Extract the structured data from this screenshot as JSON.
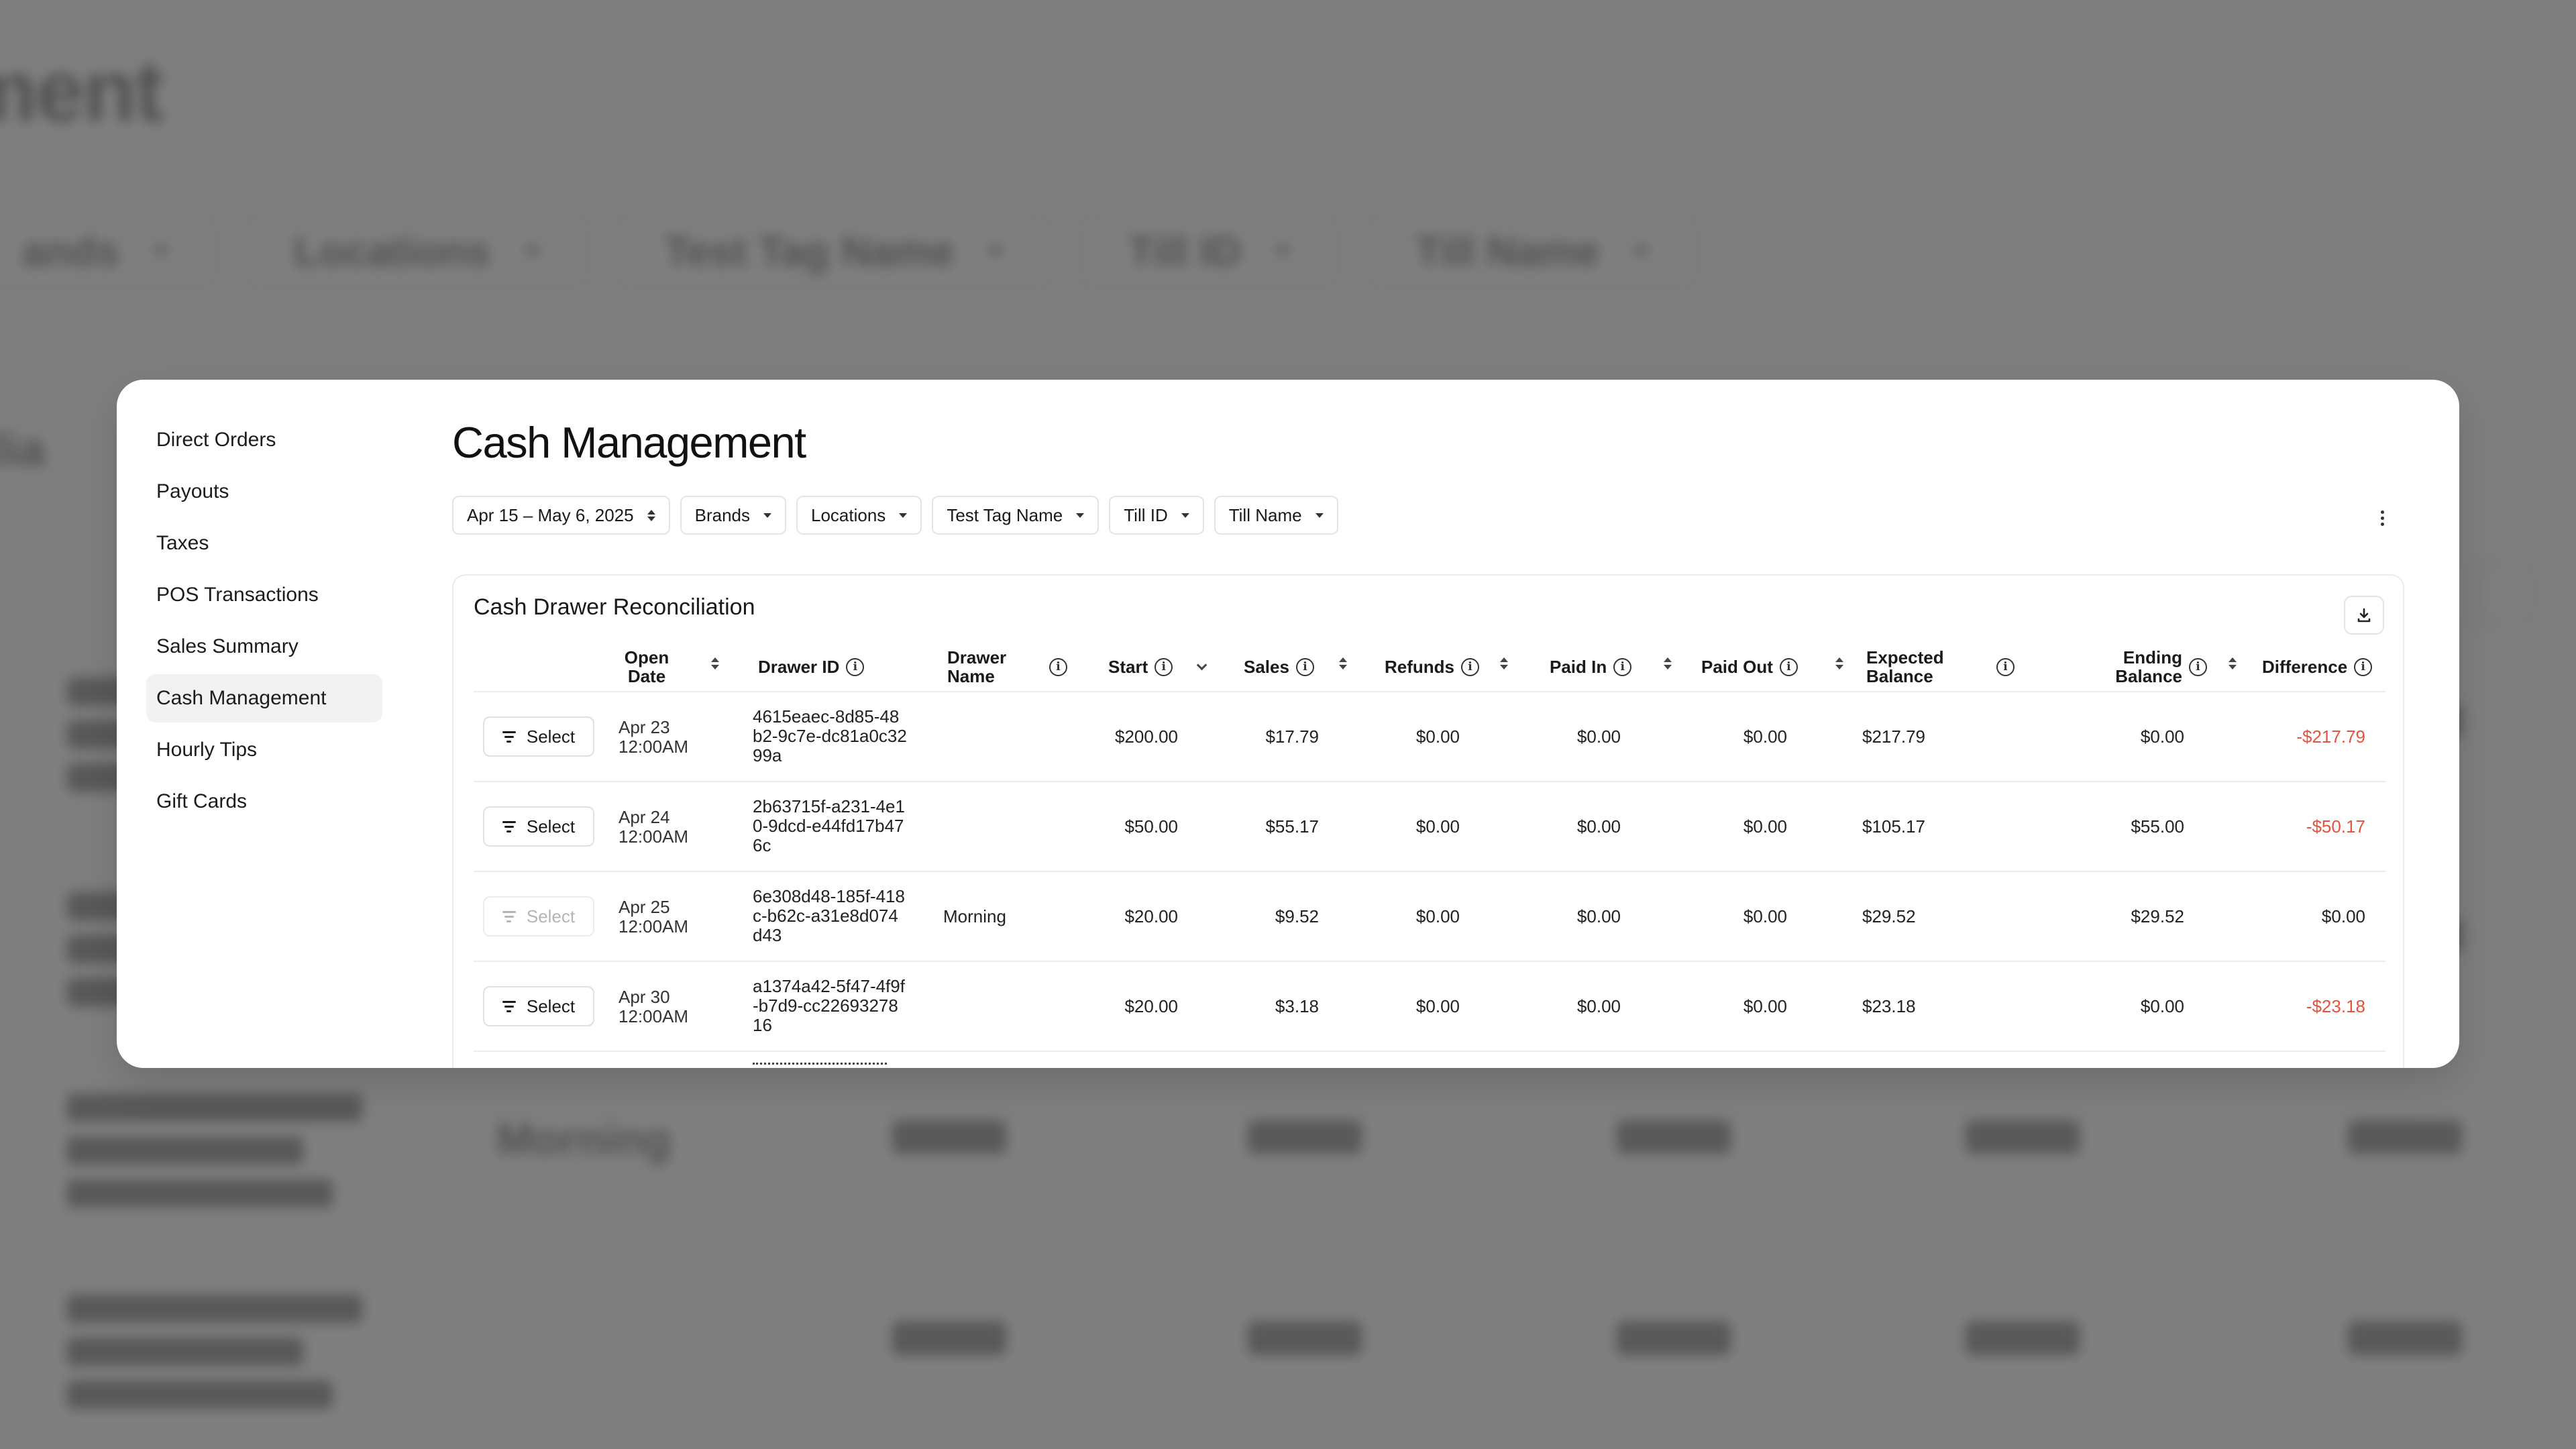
{
  "background": {
    "title": "ment",
    "filters": [
      "ands",
      "Locations",
      "Test Tag Name",
      "Till ID",
      "Till Name"
    ],
    "subtitle": "ilia",
    "row_words": [
      "Morning"
    ]
  },
  "sidebar": {
    "items": [
      {
        "label": "Direct Orders"
      },
      {
        "label": "Payouts"
      },
      {
        "label": "Taxes"
      },
      {
        "label": "POS Transactions"
      },
      {
        "label": "Sales Summary"
      },
      {
        "label": "Cash Management"
      },
      {
        "label": "Hourly Tips"
      },
      {
        "label": "Gift Cards"
      }
    ],
    "active": "Cash Management"
  },
  "main": {
    "title": "Cash Management",
    "filters": {
      "date_range": "Apr 15 – May 6, 2025",
      "brands": "Brands",
      "locations": "Locations",
      "test_tag": "Test Tag Name",
      "till_id": "Till ID",
      "till_name": "Till Name"
    }
  },
  "table": {
    "title": "Cash Drawer Reconciliation",
    "headers": {
      "open_date": "Open Date",
      "drawer_id": "Drawer ID",
      "drawer_name": "Drawer Name",
      "start": "Start",
      "sales": "Sales",
      "refunds": "Refunds",
      "paid_in": "Paid In",
      "paid_out": "Paid Out",
      "expected_balance": "Expected Balance",
      "ending_balance": "Ending Balance",
      "difference": "Difference"
    },
    "select_label": "Select",
    "rows": [
      {
        "date": "Apr 23",
        "time": "12:00AM",
        "drawer_id": "4615eaec-8d85-48b2-9c7e-dc81a0c3299a",
        "drawer_name": "",
        "start": "$200.00",
        "sales": "$17.79",
        "refunds": "$0.00",
        "paid_in": "$0.00",
        "paid_out": "$0.00",
        "expected": "$217.79",
        "ending": "$0.00",
        "difference": "-$217.79",
        "negative": true,
        "select_disabled": false
      },
      {
        "date": "Apr 24",
        "time": "12:00AM",
        "drawer_id": "2b63715f-a231-4e10-9dcd-e44fd17b476c",
        "drawer_name": "",
        "start": "$50.00",
        "sales": "$55.17",
        "refunds": "$0.00",
        "paid_in": "$0.00",
        "paid_out": "$0.00",
        "expected": "$105.17",
        "ending": "$55.00",
        "difference": "-$50.17",
        "negative": true,
        "select_disabled": false
      },
      {
        "date": "Apr 25",
        "time": "12:00AM",
        "drawer_id": "6e308d48-185f-418c-b62c-a31e8d074d43",
        "drawer_name": "Morning",
        "start": "$20.00",
        "sales": "$9.52",
        "refunds": "$0.00",
        "paid_in": "$0.00",
        "paid_out": "$0.00",
        "expected": "$29.52",
        "ending": "$29.52",
        "difference": "$0.00",
        "negative": false,
        "select_disabled": true
      },
      {
        "date": "Apr 30",
        "time": "12:00AM",
        "drawer_id": "a1374a42-5f47-4f9f-b7d9-cc2269327816",
        "drawer_name": "",
        "start": "$20.00",
        "sales": "$3.18",
        "refunds": "$0.00",
        "paid_in": "$0.00",
        "paid_out": "$0.00",
        "expected": "$23.18",
        "ending": "$0.00",
        "difference": "-$23.18",
        "negative": true,
        "select_disabled": false
      }
    ]
  },
  "colors": {
    "negative": "#e5533d",
    "overlay": "#7f7f7f",
    "active_nav": "#f2f2f3"
  }
}
